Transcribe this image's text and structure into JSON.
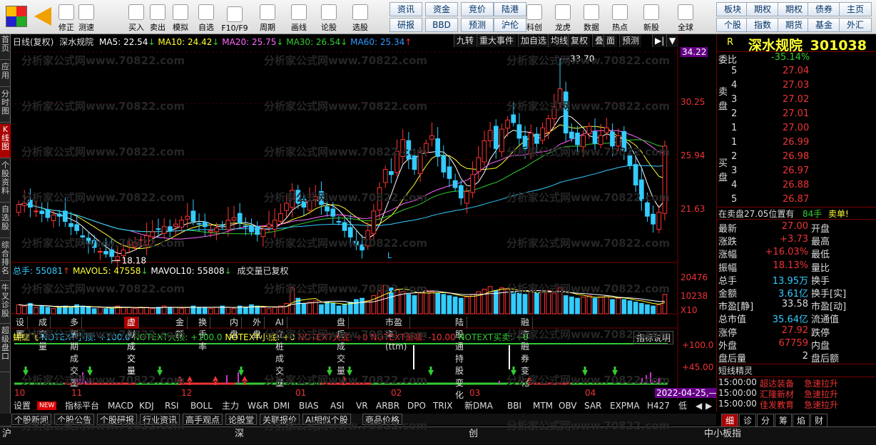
{
  "toolbar": {
    "buttons": [
      {
        "label": "修正",
        "icon": "up-icon"
      },
      {
        "label": "测速",
        "icon": "clock-icon"
      },
      {
        "label": "买入",
        "icon": "buy-icon"
      },
      {
        "label": "卖出",
        "icon": "sell-icon"
      },
      {
        "label": "模拟",
        "icon": "hammer-icon"
      },
      {
        "label": "自选",
        "icon": "star-icon"
      },
      {
        "label": "F10/F9",
        "icon": "doc-icon"
      },
      {
        "label": "周期",
        "icon": "cycle-icon"
      },
      {
        "label": "画线",
        "icon": "pencil-icon"
      },
      {
        "label": "论股",
        "icon": "lun-icon"
      },
      {
        "label": "选股",
        "icon": "search-chart-icon"
      },
      {
        "label": "科创",
        "icon": "science-icon"
      },
      {
        "label": "龙虎",
        "icon": "dragon-icon"
      },
      {
        "label": "数据",
        "icon": "pe-icon"
      },
      {
        "label": "热点",
        "icon": "hot-icon"
      },
      {
        "label": "新股",
        "icon": "new-icon"
      },
      {
        "label": "全球",
        "icon": "globe-icon"
      }
    ],
    "quick_row1": [
      "资讯",
      "资金",
      "竞价",
      "陆港",
      "板块",
      "期权",
      "期权",
      "债券",
      "主页"
    ],
    "quick_row2": [
      "研报",
      "BBD",
      "预测",
      "沪伦",
      "个股",
      "指数",
      "期货",
      "基金",
      "外汇"
    ]
  },
  "leftnav": [
    "首页",
    "应用",
    "分时图",
    "K线图",
    "个股资料",
    "自选股",
    "综合排名",
    "牛叉诊股",
    "超级盘口"
  ],
  "chart_header": {
    "title": "日线(复权)",
    "name": "深水规院",
    "ma5": "MA5: 22.54",
    "ma10": "MA10: 24.42",
    "ma20": "MA20: 25.75",
    "ma30": "MA30: 26.54",
    "ma60": "MA60: 25.34"
  },
  "topbtns": [
    "九转",
    "重大事件",
    "加自选",
    "均线",
    "复权",
    "叠",
    "面",
    "预测"
  ],
  "y_labels": [
    "34.22",
    "30.25",
    "25.94",
    "21.63"
  ],
  "vol_header": {
    "total": "总手: 55081",
    "mavol5": "MAVOL5: 47558",
    "mavol10": "MAVOL10: 55808",
    "note": "成交量已复权"
  },
  "vol_labels": [
    "20476",
    "10238",
    "X10"
  ],
  "tabs": [
    "设置",
    "成交量",
    "多周期成交量",
    "虚拟成交量",
    "金额",
    "换手率",
    "内盘",
    "外盘",
    "AI立桩成交量",
    "盘后成交量",
    "市盈率(ttm)",
    "陆股通持股变化",
    "融资融券变化"
  ],
  "ind_header": {
    "name": "蝴蝶飞",
    "t1": "NOTEXT小顶: +100.0",
    "t2": "NOTEXT大顶: +100.0",
    "t3": "NOTEXT小底: +0",
    "t4": "NOTEXT大底: +0",
    "t5": "NOTEXT萧啸: -10.00",
    "t6": "NOTEXT买卖: +0",
    "help": "指标说明"
  },
  "ind_labels": [
    "+100.0",
    "+45.00"
  ],
  "x_labels": [
    "10",
    "11",
    "12",
    "01",
    "02",
    "03",
    "04"
  ],
  "date_tag": "2022-04-25,—",
  "indicators": [
    "设置",
    "NEW",
    "指标平台",
    "MACD",
    "KDJ",
    "RSI",
    "BOLL",
    "主力",
    "W&R",
    "DMI",
    "BIAS",
    "ASI",
    "VR",
    "ARBR",
    "DPO",
    "TRIX",
    "新DMA",
    "BBI",
    "MTM",
    "OBV",
    "SAR",
    "EXPMA",
    "H427",
    "低"
  ],
  "news_tabs": [
    "个股新闻",
    "个股公告",
    "个股研报",
    "行业资讯",
    "高手观点",
    "论股堂",
    "关联报价",
    "AI相似个股",
    "商品价格"
  ],
  "status": [
    "沪",
    "深",
    "创",
    "中小板指"
  ],
  "quote": {
    "name": "深水规院",
    "code": "301038",
    "r": "R",
    "weibi_label": "委比",
    "weibi": "-35.14%",
    "sell": [
      {
        "n": "5",
        "p": "27.04"
      },
      {
        "n": "4",
        "p": "27.03"
      },
      {
        "n": "3",
        "p": "27.02"
      },
      {
        "n": "2",
        "p": "27.01"
      },
      {
        "n": "1",
        "p": "27.00"
      }
    ],
    "buy": [
      {
        "n": "1",
        "p": "26.99"
      },
      {
        "n": "2",
        "p": "26.98"
      },
      {
        "n": "3",
        "p": "26.97"
      },
      {
        "n": "4",
        "p": "26.88"
      },
      {
        "n": "5",
        "p": "26.87"
      }
    ],
    "sell_label": "卖盘",
    "buy_label": "买盘",
    "notice": "在卖盘27.05位置有",
    "notice_vol": "84手",
    "notice_tag": "卖单!",
    "rows": [
      {
        "l": "最新",
        "v": "27.00",
        "l2": "开盘"
      },
      {
        "l": "涨跌",
        "v": "+3.73",
        "l2": "最高"
      },
      {
        "l": "涨幅",
        "v": "+16.03%",
        "l2": "最低"
      },
      {
        "l": "振幅",
        "v": "18.13%",
        "l2": "量比"
      },
      {
        "l": "总手",
        "v": "13.95万",
        "l2": "换手"
      },
      {
        "l": "金额",
        "v": "3.61亿",
        "l2": "换手[实]"
      },
      {
        "l": "市盈[静]",
        "v": "33.58",
        "l2": "市盈[动]"
      },
      {
        "l": "总市值",
        "v": "35.64亿",
        "l2": "流通值"
      },
      {
        "l": "涨停",
        "v": "27.92",
        "l2": "跌停"
      },
      {
        "l": "外盘",
        "v": "67759",
        "l2": "内盘"
      },
      {
        "l": "盘后量",
        "v": "2",
        "l2": "盘后额"
      }
    ],
    "short_title": "短线精灵",
    "short": [
      {
        "t": "15:00:00",
        "a": "超达装备",
        "b": "急速拉升"
      },
      {
        "t": "15:00:00",
        "a": "汇隆新材",
        "b": "急速拉升"
      },
      {
        "t": "15:00:00",
        "a": "佳发教育",
        "b": "急速拉升"
      }
    ],
    "bottom_tabs": [
      "细",
      "诊",
      "分",
      "筹",
      "焰",
      "财"
    ]
  },
  "chart_data": {
    "type": "candlestick",
    "x": [
      "10",
      "11",
      "12",
      "01",
      "02",
      "03",
      "04"
    ],
    "ylim": [
      17.5,
      34.5
    ],
    "price_levels": [
      34.22,
      30.25,
      25.94,
      21.63
    ],
    "annotations": [
      {
        "label": "33.70",
        "value": 33.7
      },
      {
        "label": "18.18",
        "value": 18.18
      }
    ],
    "closes": [
      22.5,
      22.6,
      22.3,
      22.0,
      21.8,
      21.5,
      21.7,
      21.6,
      21.2,
      20.8,
      20.5,
      20.0,
      19.5,
      19.2,
      18.9,
      18.7,
      18.5,
      18.5,
      19.0,
      19.4,
      19.6,
      19.8,
      20.1,
      20.4,
      20.6,
      20.8,
      20.5,
      21.0,
      21.3,
      21.6,
      21.2,
      21.0,
      20.8,
      20.5,
      20.7,
      20.9,
      21.3,
      21.5,
      21.1,
      20.8,
      20.4,
      20.2,
      20.6,
      21.0,
      21.3,
      21.8,
      22.6,
      23.6,
      22.6,
      22.3,
      22.8,
      23.1,
      22.5,
      22.0,
      21.6,
      21.2,
      20.5,
      20.0,
      19.4,
      19.0,
      20.5,
      22.0,
      23.8,
      25.2,
      24.8,
      26.6,
      27.5,
      26.0,
      25.2,
      26.5,
      27.2,
      27.8,
      26.2,
      25.0,
      24.5,
      23.8,
      23.0,
      23.5,
      24.8,
      26.1,
      27.4,
      28.2,
      26.8,
      28.3,
      29.0,
      28.8,
      27.6,
      26.8,
      28.0,
      27.2,
      28.4,
      29.1,
      30.0,
      31.4,
      28.0,
      27.6,
      27.1,
      27.8,
      28.5,
      27.2,
      27.8,
      28.4,
      27.0,
      27.8,
      26.6,
      25.5,
      24.0,
      22.8,
      21.6,
      21.0,
      21.9,
      27.0
    ],
    "volume": [
      7,
      6,
      8,
      5,
      6,
      5,
      4,
      5,
      6,
      5,
      7,
      6,
      5,
      4,
      5,
      4,
      4,
      6,
      5,
      5,
      4,
      5,
      5,
      4,
      5,
      6,
      5,
      5,
      4,
      5,
      6,
      5,
      5,
      4,
      5,
      6,
      5,
      4,
      6,
      5,
      7,
      6,
      5,
      4,
      5,
      6,
      8,
      20,
      12,
      8,
      9,
      10,
      7,
      9,
      8,
      6,
      7,
      9,
      11,
      12,
      10,
      14,
      18,
      22,
      20,
      19,
      17,
      15,
      14,
      16,
      18,
      17,
      16,
      15,
      14,
      13,
      12,
      13,
      15,
      17,
      19,
      21,
      18,
      20,
      19,
      17,
      16,
      15,
      18,
      16,
      17,
      18,
      16,
      20,
      14,
      13,
      12,
      13,
      14,
      12,
      13,
      14,
      11,
      12,
      11,
      10,
      9,
      8,
      7,
      6,
      7,
      15
    ]
  }
}
